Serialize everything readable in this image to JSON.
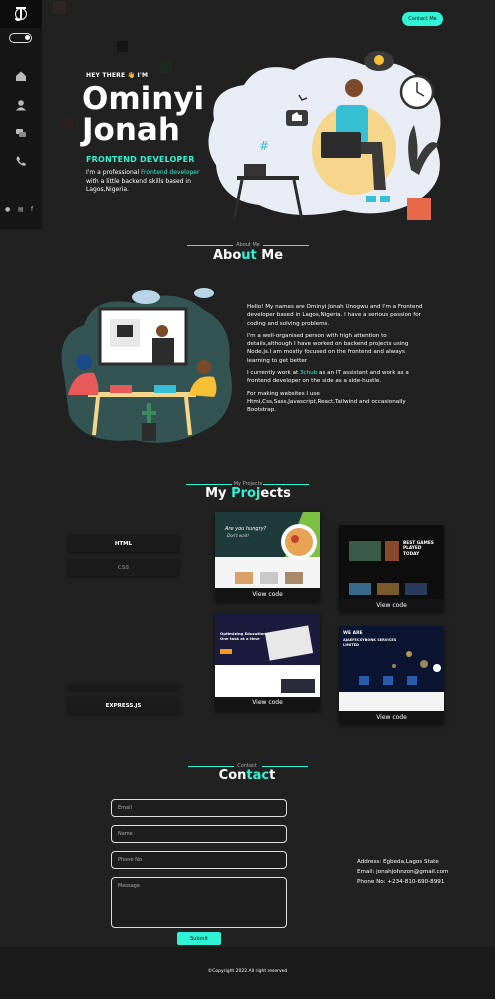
{
  "nav": {
    "logo_icon": "jonah-monogram-icon",
    "items": [
      "home-icon",
      "user-icon",
      "chat-icon",
      "phone-icon"
    ],
    "social": [
      "github-icon",
      "mail-icon",
      "facebook-icon"
    ],
    "contact_label": "Contact Me"
  },
  "hero": {
    "greeting": "HEY THERE 👋 I'M",
    "name_line1": "Ominyi",
    "name_line2": "Jonah",
    "role": "FRONTEND DEVELOPER",
    "desc_a": "I'm a professional ",
    "desc_hl": "Frontend developer",
    "desc_b": " with a little backend skills based in Lagos,Nigeria."
  },
  "about": {
    "sub": "About Me",
    "title_a": "Abo",
    "title_hl": "ut",
    "title_b": " Me",
    "p1": "Hello! My names are Ominyi Jonah Unogwu and I'm a Frontend developer based in Lagos,Nigeria. I have a serious passion for coding and solving problems.",
    "p2": "I'm a well-organised person with high attention to details,although I have worked on backend projects using Node.js.I am mostly focused on the frontend and always learning to get better",
    "p3_a": "I currently work at ",
    "p3_hl": "3chub",
    "p3_b": " as an IT assistant and work as a frontend developer on the side as a side-hustle.",
    "p4": "For making websites I use Html,Css,Sass,Javascript,React,Tailwind and occasionally Bootstrap."
  },
  "projects": {
    "sub": "My Projects",
    "title_a": "My ",
    "title_hl": "Proj",
    "title_b": "ects",
    "skills": [
      "HTML",
      "CSS",
      "EXPRESS.JS"
    ],
    "card_label": "View code",
    "thumb_texts": {
      "food_heading": "Are you hungry?",
      "food_sub": "Don't wait!",
      "game_heading": "BEST GAMES PLAYED TODAY",
      "edu_heading": "Optimizing Education One task at a time",
      "company_heading": "WE ARE",
      "company_name": "AJAEFECXYBONK SERVICES LIMITED"
    }
  },
  "contact": {
    "sub": "Contact",
    "title_a": "Con",
    "title_hl": "tac",
    "title_b": "t",
    "email_ph": "Email",
    "name_ph": "Name",
    "phone_ph": "Phone No",
    "message_ph": "Message",
    "submit": "Submit",
    "address": "Address:  Egbeda,Lagos State",
    "email": "Email:  jonahjohnzon@gmail.com",
    "phone": "Phone No:  +234-810-690-8991"
  },
  "footer": {
    "copyright": "©Copyright 2022.All right reserved"
  },
  "colors": {
    "accent": "#2ff3d4",
    "bg": "#212121",
    "sidebar": "#161616"
  }
}
